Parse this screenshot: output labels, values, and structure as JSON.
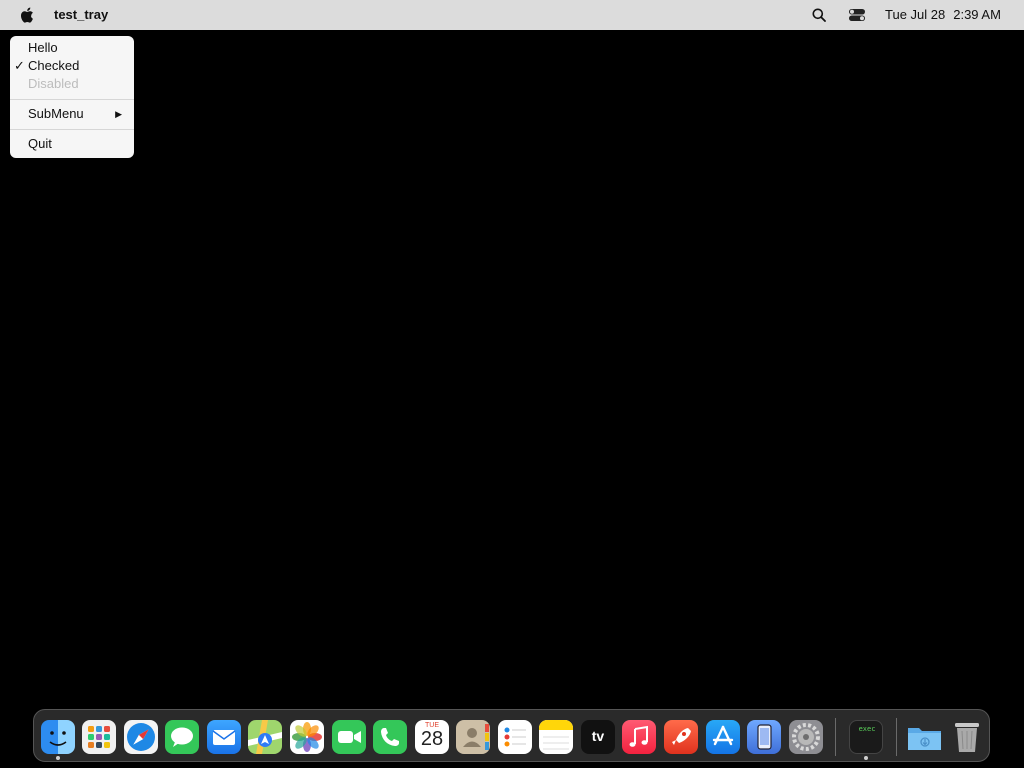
{
  "menubar": {
    "app_name": "test_tray",
    "date": "Tue Jul 28",
    "time": "2:39 AM"
  },
  "menu": {
    "items": [
      {
        "label": "Hello",
        "checked": false,
        "disabled": false
      },
      {
        "label": "Checked",
        "checked": true,
        "disabled": false
      },
      {
        "label": "Disabled",
        "checked": false,
        "disabled": true
      },
      {
        "label": "SubMenu",
        "submenu": true
      },
      {
        "label": "Quit"
      }
    ],
    "check_mark": "✓",
    "submenu_arrow": "▶"
  },
  "dock": {
    "calendar_month": "TUE",
    "calendar_day": "28",
    "tv_label": "tv",
    "exec_label": "exec",
    "apps": [
      "finder",
      "launchpad",
      "safari",
      "messages",
      "mail",
      "maps",
      "photos",
      "facetime",
      "phone",
      "calendar",
      "contacts",
      "reminders",
      "notes",
      "tv",
      "music",
      "rocket",
      "app-store",
      "simulator",
      "system-settings",
      "terminal-exec",
      "downloads-folder",
      "trash"
    ]
  },
  "colors": {
    "menubar_bg": "#dcdcdc",
    "desktop_bg": "#000000",
    "menu_bg": "#f6f6f6",
    "disabled_text": "#bcbcbc"
  }
}
